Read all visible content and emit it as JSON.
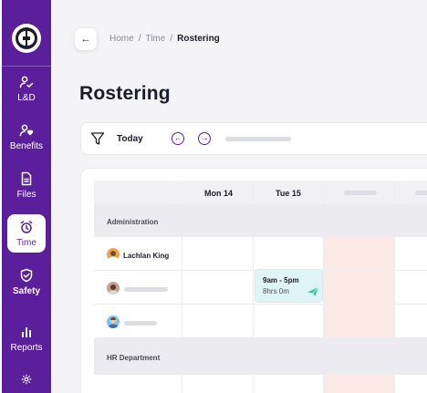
{
  "sidebar": {
    "items": [
      {
        "label": "L&D",
        "icon": "user-learning-icon"
      },
      {
        "label": "Benefits",
        "icon": "user-heart-icon"
      },
      {
        "label": "Files",
        "icon": "file-icon"
      },
      {
        "label": "Time",
        "icon": "alarm-clock-icon"
      },
      {
        "label": "Safety",
        "icon": "shield-icon"
      },
      {
        "label": "Reports",
        "icon": "bar-chart-icon"
      }
    ],
    "active": "Time"
  },
  "header": {
    "back_icon": "←",
    "breadcrumb": [
      "Home",
      "Time",
      "Rostering"
    ],
    "breadcrumb_sep": "/"
  },
  "page": {
    "title": "Rostering"
  },
  "filter": {
    "today_label": "Today",
    "prev_glyph": "←",
    "next_glyph": "→"
  },
  "roster": {
    "columns": [
      "Mon 14",
      "Tue 15"
    ],
    "groups": [
      "Administration",
      "HR Department"
    ],
    "employees": [
      "Lachlan King"
    ],
    "shift": {
      "time": "9am - 5pm",
      "duration": "8hrs 0m"
    }
  },
  "colors": {
    "brand": "#5b1f9c",
    "shift_bg": "#dff4f6",
    "unavailable_bg": "#fbe9e6"
  }
}
